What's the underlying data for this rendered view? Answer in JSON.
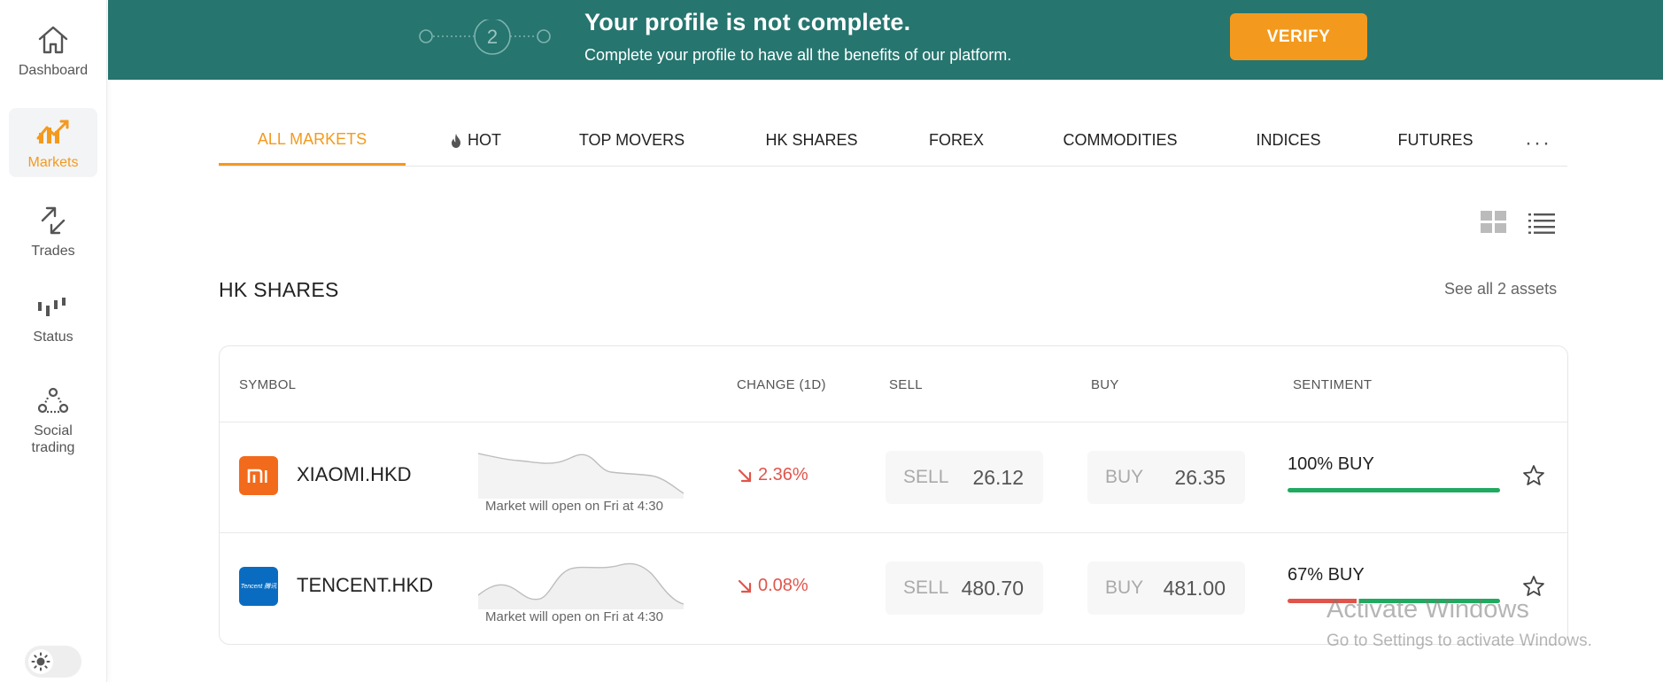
{
  "sidebar": {
    "items": [
      {
        "label": "Dashboard",
        "icon": "home-icon"
      },
      {
        "label": "Markets",
        "icon": "markets-chart-icon"
      },
      {
        "label": "Trades",
        "icon": "arrows-icon"
      },
      {
        "label": "Status",
        "icon": "status-bars-icon"
      },
      {
        "label": "Social trading",
        "icon": "social-network-icon"
      }
    ],
    "active_index": 1
  },
  "banner": {
    "step": "2",
    "title": "Your profile is not complete.",
    "subtitle": "Complete your profile to have all the benefits of our platform.",
    "verify_label": "VERIFY"
  },
  "tabs": {
    "items": [
      "ALL MARKETS",
      "HOT",
      "TOP MOVERS",
      "HK SHARES",
      "FOREX",
      "COMMODITIES",
      "INDICES",
      "FUTURES"
    ],
    "active": "ALL MARKETS",
    "more": "···"
  },
  "section": {
    "title": "HK SHARES",
    "see_all": "See all 2 assets"
  },
  "table": {
    "headers": {
      "symbol": "SYMBOL",
      "change": "CHANGE (1D)",
      "sell": "SELL",
      "buy": "BUY",
      "sentiment": "SENTIMENT"
    },
    "rows": [
      {
        "logo_text": "mi",
        "logo_color": "#f26a1b",
        "symbol": "XIAOMI.HKD",
        "market_note": "Market will open on Fri at 4:30",
        "change": "2.36%",
        "sell_label": "SELL",
        "sell": "26.12",
        "buy_label": "BUY",
        "buy": "26.35",
        "sentiment": "100% BUY",
        "buy_share": 1.0
      },
      {
        "logo_text": "Tencent 腾讯",
        "logo_color": "#0a6cc0",
        "symbol": "TENCENT.HKD",
        "market_note": "Market will open on Fri at 4:30",
        "change": "0.08%",
        "sell_label": "SELL",
        "sell": "480.70",
        "buy_label": "BUY",
        "buy": "481.00",
        "sentiment": "67% BUY",
        "buy_share": 0.67
      }
    ]
  },
  "colors": {
    "accent": "#f39a1e",
    "banner": "#26756f",
    "negative": "#e0554b",
    "buy_bar": "#1faa5f",
    "sell_bar": "#e0554b"
  },
  "watermark": {
    "line1": "Activate Windows",
    "line2": "Go to Settings to activate Windows."
  }
}
